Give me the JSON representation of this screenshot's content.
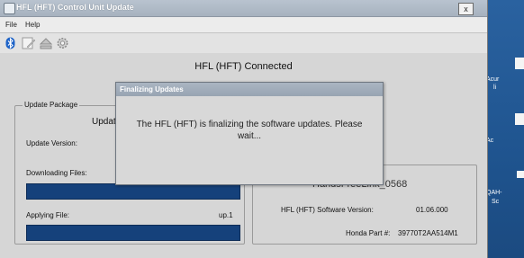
{
  "window": {
    "title": "HFL (HFT) Control Unit Update",
    "close_label": "x"
  },
  "menu": {
    "items": [
      "File",
      "Help"
    ]
  },
  "toolbar": {
    "icons": [
      "bluetooth-icon",
      "edit-document-icon",
      "eject-icon",
      "gear-icon"
    ]
  },
  "status": {
    "connection": "HFL (HFT) Connected"
  },
  "update_package": {
    "legend": "Update Package",
    "heading_partial": "Updat",
    "version_label": "Update Version:",
    "downloading_label": "Downloading Files:",
    "downloading_progress": 1.0,
    "applying_label": "Applying File:",
    "applying_value": "up.1",
    "applying_progress": 1.0
  },
  "device": {
    "name": "HandsFreeLink_0568",
    "sw_label": "HFL (HFT) Software Version:",
    "sw_value": "01.06.000",
    "part_label": "Honda Part #:",
    "part_value": "39770T2AA514M1"
  },
  "dialog": {
    "title": "Finalizing Updates",
    "line1": "The HFL (HFT) is finalizing the software updates.  Please",
    "line2": "wait..."
  },
  "desktop_icons": [
    {
      "label_1": "Acur",
      "label_2": "li"
    },
    {
      "label_1": "Ac",
      "label_2": ""
    },
    {
      "label_1": "QAH-",
      "label_2": "Sc"
    }
  ]
}
